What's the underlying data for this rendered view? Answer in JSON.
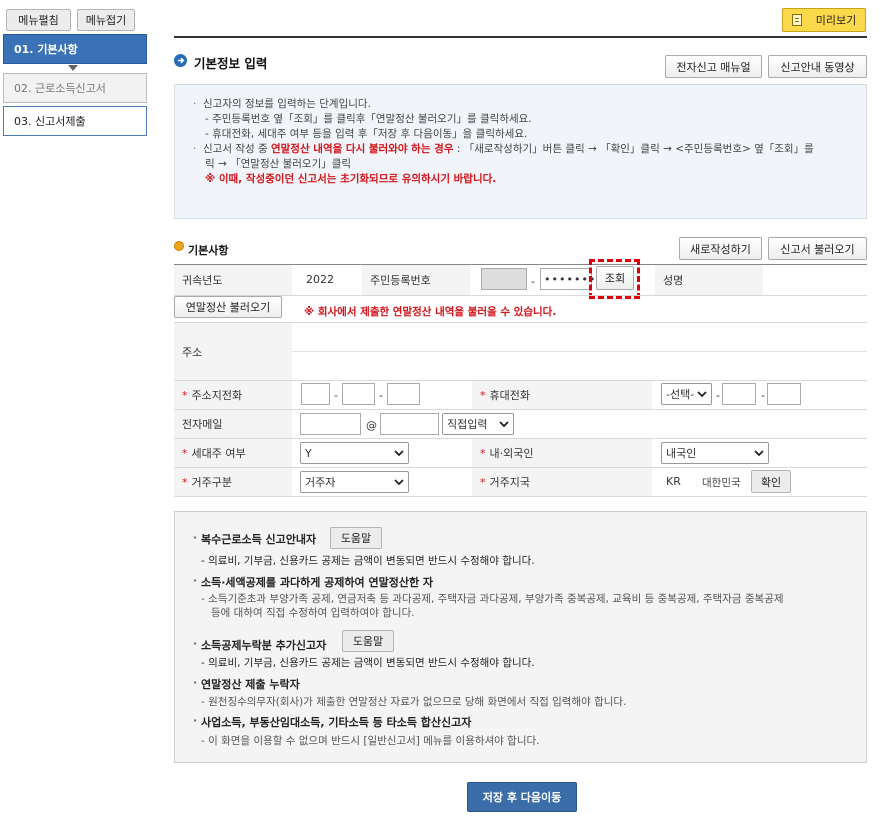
{
  "toolbar": {
    "expand_label": "메뉴펼침",
    "collapse_label": "메뉴접기",
    "preview_label": "미리보기"
  },
  "nav": {
    "items": [
      {
        "label": "01. 기본사항"
      },
      {
        "label": "02. 근로소득신고서"
      },
      {
        "label": "03. 신고서제출"
      }
    ]
  },
  "header": {
    "title": "기본정보 입력",
    "manual_label": "전자신고 매뉴얼",
    "video_label": "신고안내 동영상"
  },
  "info": {
    "line1": "신고자의 정보를 입력하는 단계입니다.",
    "line2": "- 주민등록번호 옆「조회」를 클릭후「연말정산 불러오기」를 클릭하세요.",
    "line3": "- 휴대전화, 세대주 여부 등을 입력 후「저장 후 다음이동」을 클릭하세요.",
    "line4_a": "신고서 작성 중 ",
    "line4_b": "연말정산 내역을 다시 불러와야 하는 경우",
    "line4_c": " : 「새로작성하기」버튼 클릭 → 「확인」클릭 → <주민등록번호> 옆「조회」를",
    "line5": "릭 → 「연말정산 불러오기」클릭",
    "line6": "※ 이때, 작성중이던 신고서는 초기화되므로 유의하시기 바랍니다."
  },
  "section": {
    "title": "기본사항",
    "new_label": "새로작성하기",
    "load_label": "신고서 불러오기"
  },
  "form": {
    "year_label": "귀속년도",
    "year_value": "2022",
    "rrn_label": "주민등록번호",
    "rrn_back": "•••••••",
    "lookup_label": "조회",
    "name_label": "성명",
    "load_settlement_label": "연말정산 불러오기",
    "load_notice": "※ 회사에서 제출한 연말정산 내역을 불러올 수 있습니다.",
    "address_label": "주소",
    "home_phone_label": "주소지전화",
    "mobile_label": "휴대전화",
    "mobile_select": "-선택-",
    "email_label": "전자메일",
    "email_at": "@",
    "email_select": "직접입력",
    "household_label": "세대주 여부",
    "household_value": "Y",
    "nationality_label": "내·외국인",
    "nationality_value": "내국인",
    "residence_type_label": "거주구분",
    "residence_type_value": "거주자",
    "residence_country_label": "거주지국",
    "country_code": "KR",
    "country_name": "대한민국",
    "confirm_label": "확인"
  },
  "notes": {
    "h1": "복수근로소득 신고안내자",
    "help1": "도움말",
    "s1": "- 의료비, 기부금, 신용카드 공제는 금액이 변동되면 반드시 수정해야 합니다.",
    "h2": "소득·세액공제를 과다하게 공제하여 연말정산한 자",
    "s2a": "- 소득기준초과 부양가족 공제, 연금저축 등 과다공제, 주택자금 과다공제, 부양가족 중복공제, 교육비 등 중복공제, 주택자금 중복공제",
    "s2b": "등에 대하여 직접 수정하여 입력하여야 합니다.",
    "h3": "소득공제누락분 추가신고자",
    "help2": "도움말",
    "s3": "- 의료비, 기부금, 신용카드 공제는 금액이 변동되면 반드시 수정해야 합니다.",
    "h4": "연말정산 제출 누락자",
    "s4": "- 원천징수의무자(회사)가 제출한 연말정산 자료가 없으므로 당해 화면에서 직접 입력해야 합니다.",
    "h5": "사업소득, 부동산임대소득, 기타소득 등 타소득 합산신고자",
    "s5": "- 이 화면을 이용할 수 없으며 반드시 [일반신고서] 메뉴를 이용하셔야 합니다."
  },
  "footer": {
    "save_next_label": "저장 후 다음이동"
  },
  "colors": {
    "nav_active": "#3a72b8",
    "preview_bg": "#fbd94a",
    "save_button": "#3b6ea8",
    "warning_red": "#d3141a",
    "highlight_dash": "#e0000a"
  }
}
